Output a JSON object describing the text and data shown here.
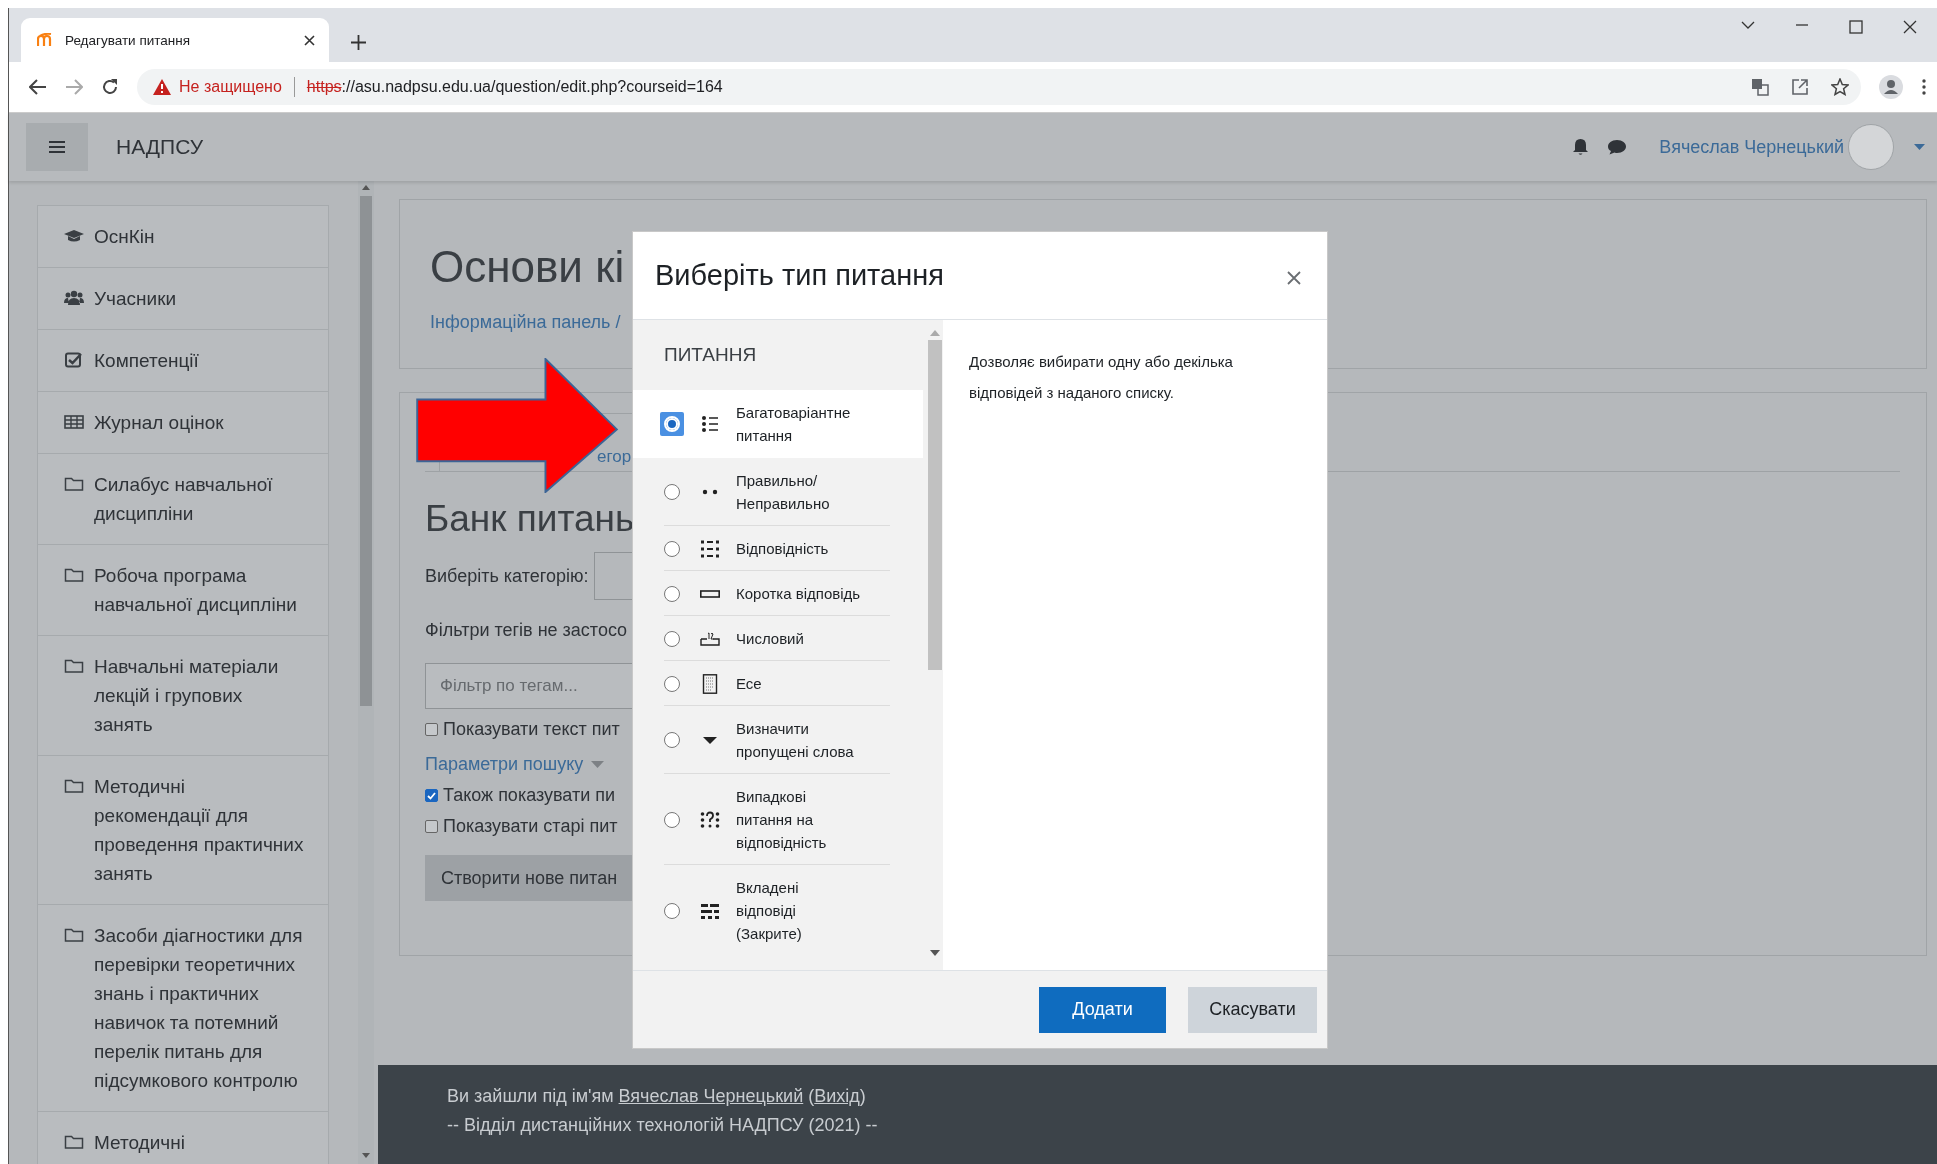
{
  "browser": {
    "tab": {
      "title": "Редагувати питання"
    },
    "address": {
      "security": "Не защищено",
      "scheme": "https",
      "url_rest": "://asu.nadpsu.edu.ua/question/edit.php?courseid=164"
    }
  },
  "navbar": {
    "site_name": "НАДПСУ",
    "user_name": "Вячеслав Чернецький"
  },
  "sidebar": {
    "items": [
      {
        "label": "ОснКін",
        "kind": "course"
      },
      {
        "label": "Учасники",
        "kind": "participants"
      },
      {
        "label": "Компетенції",
        "kind": "competencies"
      },
      {
        "label": "Журнал оцінок",
        "kind": "grades"
      },
      {
        "label": "Силабус навчальної дисципліни",
        "kind": "section"
      },
      {
        "label": "Робоча програма навчальної дисципліни",
        "kind": "section"
      },
      {
        "label": "Навчальні матеріали лекцій і групових занять",
        "kind": "section"
      },
      {
        "label": "Методичні рекомендації для проведення практичних занять",
        "kind": "section"
      },
      {
        "label": "Засоби діагностики для перевірки теоретичних знань і практичних навичок та потемний перелік питань для підсумкового контролю",
        "kind": "section"
      },
      {
        "label": "Методичні",
        "kind": "section"
      }
    ]
  },
  "page": {
    "title": "Основи кі",
    "breadcrumb": "Інформаційна панель /"
  },
  "bank": {
    "tab": "егор",
    "heading": "Банк питань",
    "category_label": "Виберіть категорію:",
    "filter_note": "Фільтри тегів не застосо",
    "tag_filter": {
      "placeholder": "Фільтр по тегам..."
    },
    "options": [
      {
        "kind": "checkbox",
        "label": "Показувати текст пит",
        "checked": false
      },
      {
        "kind": "link",
        "label": "Параметри пошуку"
      },
      {
        "kind": "checkbox",
        "label": "Також показувати пи",
        "checked": true
      },
      {
        "kind": "checkbox",
        "label": "Показувати старі пит",
        "checked": false
      }
    ],
    "create_button": "Створити нове питан"
  },
  "modal": {
    "title": "Виберіть тип питання",
    "section": "ПИТАННЯ",
    "types": [
      {
        "label": "Багатоваріантне питання",
        "kind": "multichoice",
        "selected": true
      },
      {
        "label": "Правильно/ Неправильно",
        "kind": "truefalse",
        "selected": false
      },
      {
        "label": "Відповідність",
        "kind": "match",
        "selected": false
      },
      {
        "label": "Коротка відповідь",
        "kind": "shortanswer",
        "selected": false
      },
      {
        "label": "Числовий",
        "kind": "numerical",
        "selected": false
      },
      {
        "label": "Есе",
        "kind": "essay",
        "selected": false
      },
      {
        "label": "Визначити пропущені слова",
        "kind": "gapselect",
        "selected": false
      },
      {
        "label": "Випадкові питання на відповідність",
        "kind": "randomsamatch",
        "selected": false
      },
      {
        "label": "Вкладені відповіді (Закрите)",
        "kind": "multianswer",
        "selected": false
      }
    ],
    "description": "Дозволяє вибирати одну або декілька відповідей з наданого списку.",
    "add_button": "Додати",
    "cancel_button": "Скасувати"
  },
  "footer": {
    "login": [
      {
        "kind": "text",
        "text": "Ви зайшли під ім'ям "
      },
      {
        "kind": "link",
        "text": "Вячеслав Чернецький"
      },
      {
        "kind": "text",
        "text": " ("
      },
      {
        "kind": "link",
        "text": "Вихід"
      },
      {
        "kind": "text",
        "text": ")"
      }
    ],
    "credit": "-- Відділ дистанційних технологій НАДПСУ (2021) --"
  }
}
